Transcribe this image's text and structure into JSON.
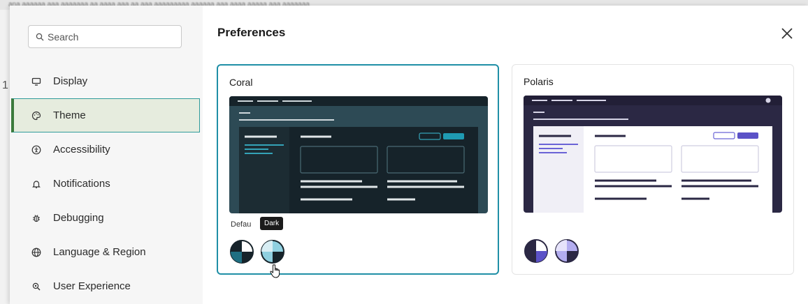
{
  "background": {
    "strip_text": "ana aaaaaa aaa aaaaaaa aa aaaa aaa aa aaa aaaaaaaaa aaaaaa aaa aaaa aaaaa aaa aaaaaaa"
  },
  "sidebar": {
    "search": {
      "placeholder": "Search"
    },
    "items": [
      {
        "label": "Display",
        "icon": "monitor-icon",
        "active": false
      },
      {
        "label": "Theme",
        "icon": "palette-icon",
        "active": true
      },
      {
        "label": "Accessibility",
        "icon": "accessibility-icon",
        "active": false
      },
      {
        "label": "Notifications",
        "icon": "bell-icon",
        "active": false
      },
      {
        "label": "Debugging",
        "icon": "bug-icon",
        "active": false
      },
      {
        "label": "Language & Region",
        "icon": "globe-icon",
        "active": false
      },
      {
        "label": "User Experience",
        "icon": "user-experience-icon",
        "active": false
      }
    ]
  },
  "main": {
    "title": "Preferences",
    "close_icon": "close-icon",
    "themes": [
      {
        "name": "Coral",
        "selected": true,
        "variant_label": "Defau",
        "tooltip": "Dark",
        "colors": {
          "border": "#1f8fa6",
          "preview_bg": "#2d4a55",
          "panel": "#16232a"
        }
      },
      {
        "name": "Polaris",
        "selected": false,
        "colors": {
          "border": "#e3e3e3",
          "preview_bg": "#2b2844",
          "panel": "#ffffff",
          "accent": "#5b52c7"
        }
      }
    ]
  },
  "colors": {
    "accent_teal": "#1f8fa6",
    "active_bg": "#e6ecde",
    "polaris_accent": "#5b52c7"
  }
}
